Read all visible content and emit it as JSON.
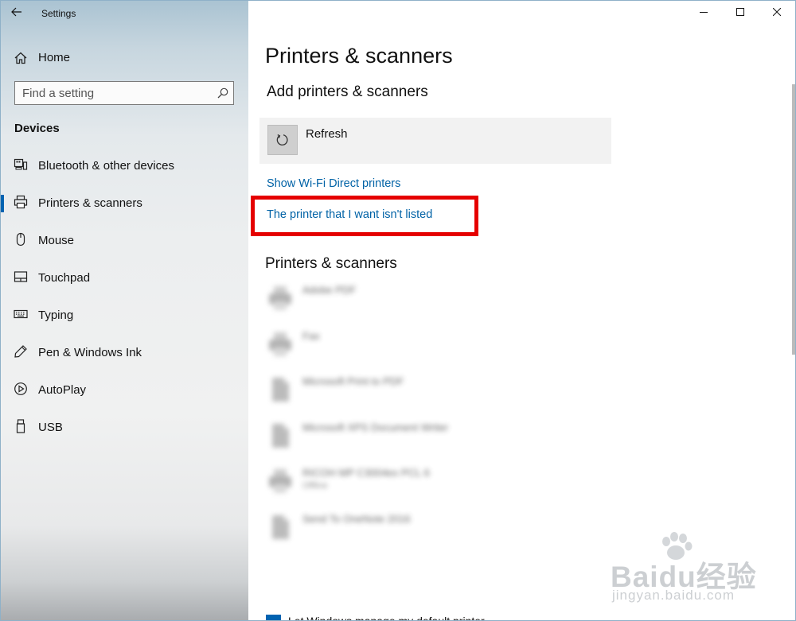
{
  "window": {
    "app_title": "Settings"
  },
  "sidebar": {
    "home_label": "Home",
    "search_placeholder": "Find a setting",
    "section_heading": "Devices",
    "items": [
      {
        "label": "Bluetooth & other devices",
        "icon": "bluetooth-devices-icon",
        "selected": false
      },
      {
        "label": "Printers & scanners",
        "icon": "printer-icon",
        "selected": true
      },
      {
        "label": "Mouse",
        "icon": "mouse-icon",
        "selected": false
      },
      {
        "label": "Touchpad",
        "icon": "touchpad-icon",
        "selected": false
      },
      {
        "label": "Typing",
        "icon": "keyboard-icon",
        "selected": false
      },
      {
        "label": "Pen & Windows Ink",
        "icon": "pen-icon",
        "selected": false
      },
      {
        "label": "AutoPlay",
        "icon": "autoplay-icon",
        "selected": false
      },
      {
        "label": "USB",
        "icon": "usb-icon",
        "selected": false
      }
    ]
  },
  "main": {
    "page_title": "Printers & scanners",
    "add_heading": "Add printers & scanners",
    "refresh_label": "Refresh",
    "wifi_direct_link": "Show Wi-Fi Direct printers",
    "not_listed_link": "The printer that I want isn't listed",
    "list_heading": "Printers & scanners",
    "printers": [
      {
        "name": "Adobe PDF",
        "status": "",
        "icon": "printer-icon"
      },
      {
        "name": "Fax",
        "status": "",
        "icon": "printer-icon"
      },
      {
        "name": "Microsoft Print to PDF",
        "status": "",
        "icon": "document-icon"
      },
      {
        "name": "Microsoft XPS Document Writer",
        "status": "",
        "icon": "document-icon"
      },
      {
        "name": "RICOH MP C3004ex PCL 6",
        "status": "Offline",
        "icon": "printer-icon"
      },
      {
        "name": "Send To OneNote 2016",
        "status": "",
        "icon": "document-icon"
      }
    ],
    "bottom_checkbox_label": "Let Windows manage my default printer"
  },
  "colors": {
    "accent": "#0063b1",
    "link": "#0062a6",
    "highlight": "#e50000"
  },
  "watermark": {
    "brand": "Baidu经验",
    "url": "jingyan.baidu.com"
  }
}
